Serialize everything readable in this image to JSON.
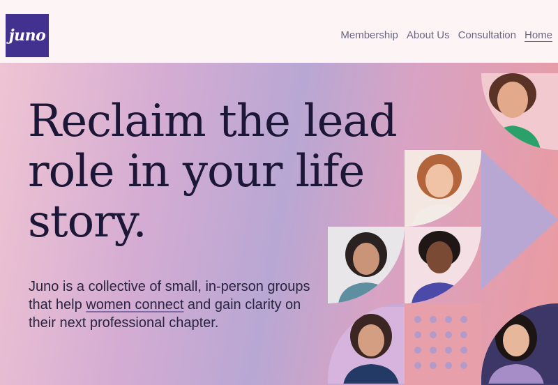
{
  "header": {
    "logo_text": "juno",
    "nav": [
      {
        "label": "Membership"
      },
      {
        "label": "About Us"
      },
      {
        "label": "Consultation"
      },
      {
        "label": "Home"
      }
    ]
  },
  "hero": {
    "headline_lines": [
      "Reclaim the lead",
      "role in your life",
      "story."
    ],
    "body_before": "Juno is a collective of small, in-person groups that help ",
    "body_link": "women connect",
    "body_after": " and gain clarity on their next professional chapter."
  },
  "colors": {
    "brand": "#43318f",
    "headline": "#1c1737",
    "nav_text": "#6b6684"
  }
}
